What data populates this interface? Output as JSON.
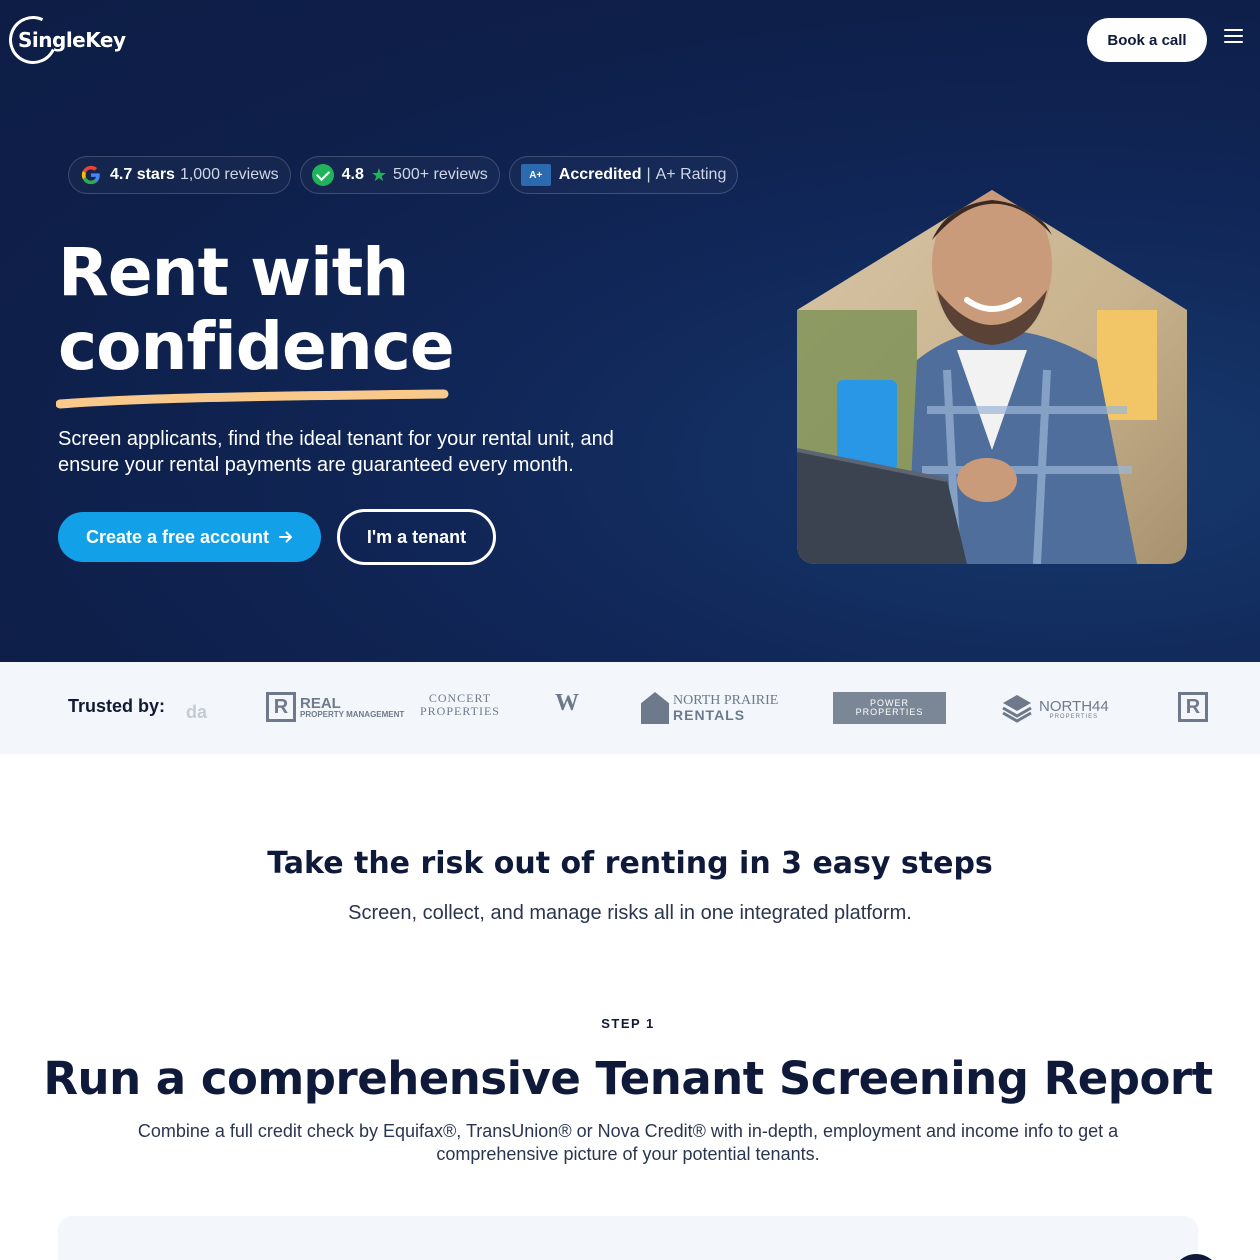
{
  "header": {
    "logo_text": "SingleKey",
    "book_call_label": "Book a call",
    "menu_icon": "hamburger-menu-icon"
  },
  "badges": {
    "google": {
      "rating": "4.7 stars",
      "reviews": "1,000 reviews",
      "icon": "google-icon"
    },
    "trustpilot": {
      "rating": "4.8",
      "reviews": "500+ reviews",
      "icon": "check-circle-icon",
      "star_icon": "star-icon"
    },
    "bbb": {
      "label": "Accredited",
      "sep": "|",
      "rating": "A+ Rating",
      "icon": "bbb-icon",
      "icon_text": "A+"
    }
  },
  "hero": {
    "headline_line1": "Rent with",
    "headline_line2": "confidence",
    "subtext": "Screen applicants, find the ideal tenant for your rental unit, and ensure your rental payments are guaranteed every month.",
    "cta_primary": "Create a free account",
    "cta_primary_icon": "arrow-right-icon",
    "cta_secondary": "I'm a tenant",
    "accent_color": "#12a0e8",
    "underline_color": "#f8c98a"
  },
  "trusted": {
    "label": "Trusted by:",
    "logos": [
      {
        "text": "da"
      },
      {
        "text": "REAL",
        "sub": "PROPERTY MANAGEMENT"
      },
      {
        "text": "CONCERT",
        "sub": "PROPERTIES"
      },
      {
        "text": "W"
      },
      {
        "text": "NORTH PRAIRIE",
        "sub": "RENTALS"
      },
      {
        "text": "POWER",
        "sub": "PROPERTIES"
      },
      {
        "text": "NORTH44",
        "sub": "PROPERTIES"
      },
      {
        "text": "R"
      }
    ]
  },
  "steps": {
    "title": "Take the risk out of renting in 3 easy steps",
    "subtitle": "Screen, collect, and manage risks all in one integrated platform.",
    "step1": {
      "label": "STEP 1",
      "title": "Run a comprehensive Tenant Screening Report",
      "description": "Combine a full credit check by Equifax®, TransUnion® or Nova Credit® with in-depth, employment and income info to get a comprehensive picture of your potential tenants."
    }
  }
}
